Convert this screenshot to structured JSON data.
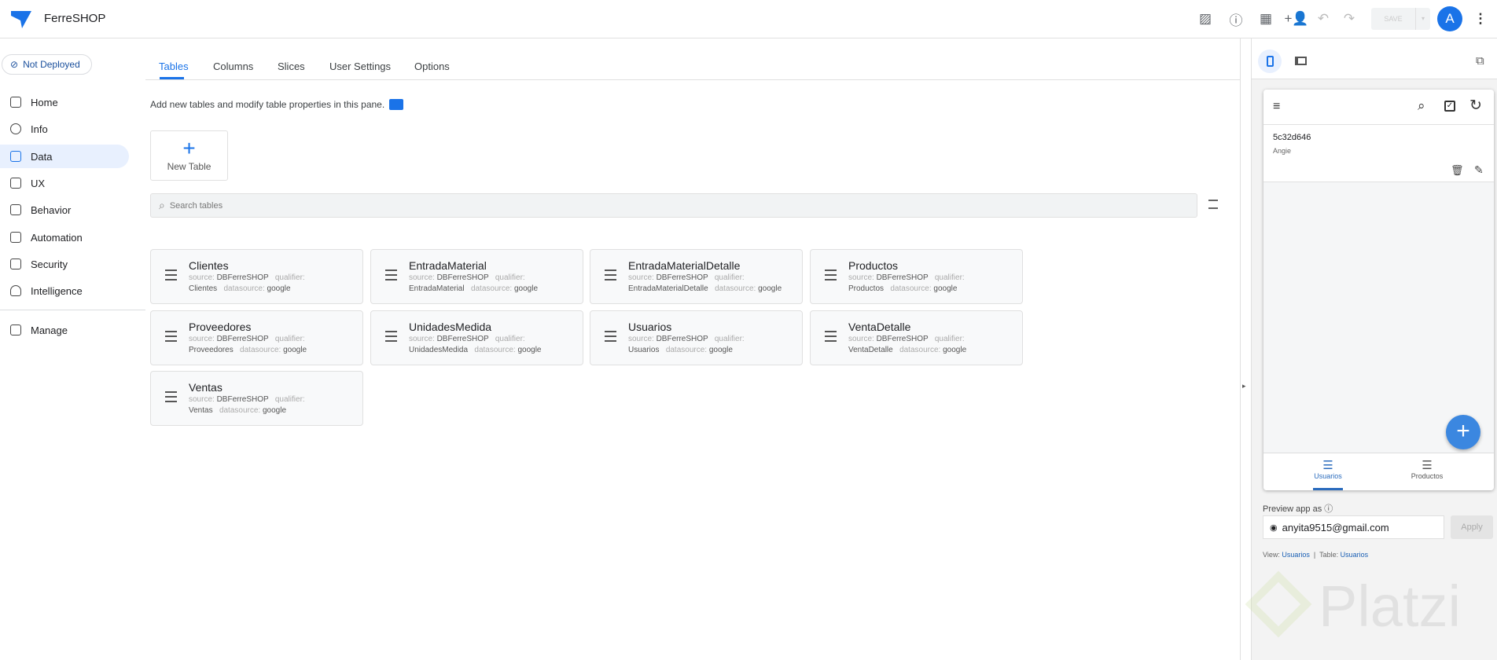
{
  "header": {
    "app_name": "FerreSHOP",
    "save_label": "SAVE",
    "avatar_letter": "A",
    "brand_color": "#1a73e8"
  },
  "sidebar": {
    "deploy_status": "Not Deployed",
    "items": [
      {
        "label": "Home"
      },
      {
        "label": "Info"
      },
      {
        "label": "Data",
        "active": true
      },
      {
        "label": "UX"
      },
      {
        "label": "Behavior"
      },
      {
        "label": "Automation"
      },
      {
        "label": "Security"
      },
      {
        "label": "Intelligence"
      },
      {
        "label": "Manage"
      }
    ]
  },
  "main": {
    "tabs": [
      {
        "label": "Tables",
        "active": true
      },
      {
        "label": "Columns"
      },
      {
        "label": "Slices"
      },
      {
        "label": "User Settings"
      },
      {
        "label": "Options"
      }
    ],
    "description": "Add new tables and modify table properties in this pane.",
    "new_table_label": "New Table",
    "search_placeholder": "Search tables",
    "labels": {
      "source": "source:",
      "qualifier": "qualifier:",
      "datasource": "datasource:"
    },
    "tables": [
      {
        "name": "Clientes",
        "source": "DBFerreSHOP",
        "qualifier": "Clientes",
        "datasource": "google",
        "icon": "table-indent-icon"
      },
      {
        "name": "EntradaMaterial",
        "source": "DBFerreSHOP",
        "qualifier": "EntradaMaterial",
        "datasource": "google",
        "icon": "table-indent-icon"
      },
      {
        "name": "EntradaMaterialDetalle",
        "source": "DBFerreSHOP",
        "qualifier": "EntradaMaterialDetalle",
        "datasource": "google",
        "icon": "table-indent-icon"
      },
      {
        "name": "Productos",
        "source": "DBFerreSHOP",
        "qualifier": "Productos",
        "datasource": "google",
        "icon": "list-icon"
      },
      {
        "name": "Proveedores",
        "source": "DBFerreSHOP",
        "qualifier": "Proveedores",
        "datasource": "google",
        "icon": "table-indent-icon"
      },
      {
        "name": "UnidadesMedida",
        "source": "DBFerreSHOP",
        "qualifier": "UnidadesMedida",
        "datasource": "google",
        "icon": "table-indent-icon"
      },
      {
        "name": "Usuarios",
        "source": "DBFerreSHOP",
        "qualifier": "Usuarios",
        "datasource": "google",
        "icon": "list-icon"
      },
      {
        "name": "VentaDetalle",
        "source": "DBFerreSHOP",
        "qualifier": "VentaDetalle",
        "datasource": "google",
        "icon": "table-indent-icon"
      },
      {
        "name": "Ventas",
        "source": "DBFerreSHOP",
        "qualifier": "Ventas",
        "datasource": "google",
        "icon": "table-indent-icon"
      }
    ]
  },
  "preview": {
    "record_id": "5c32d646",
    "record_name": "Angie",
    "nav": [
      {
        "label": "Usuarios",
        "active": true
      },
      {
        "label": "Productos"
      }
    ],
    "preview_as_label": "Preview app as",
    "email": "anyita9515@gmail.com",
    "apply_label": "Apply",
    "view_label": "View:",
    "view_value": "Usuarios",
    "separator": "|",
    "table_label": "Table:",
    "table_value": "Usuarios",
    "watermark": "Platzi"
  }
}
